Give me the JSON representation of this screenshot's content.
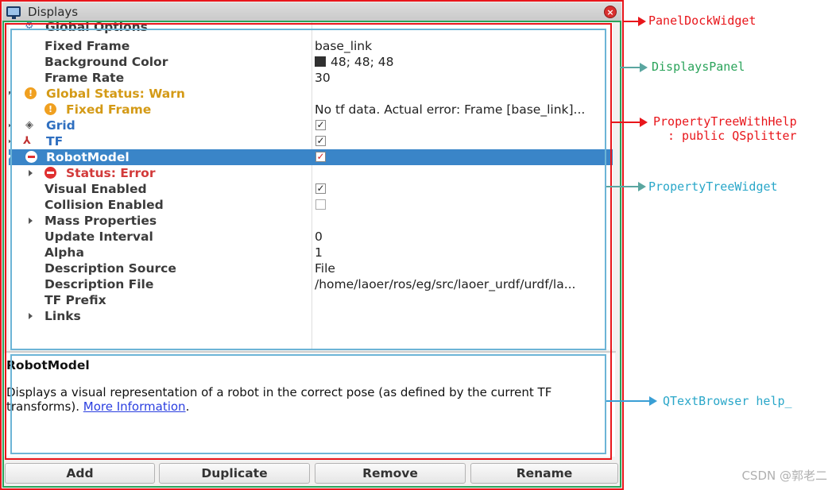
{
  "window": {
    "title": "Displays",
    "close_icon": "close-icon"
  },
  "tree": {
    "rows": [
      {
        "label": "Global Options",
        "value": ""
      },
      {
        "label": "Fixed Frame",
        "value": "base_link"
      },
      {
        "label": "Background Color",
        "value": "48; 48; 48",
        "swatch": "#303030"
      },
      {
        "label": "Frame Rate",
        "value": "30"
      },
      {
        "label": "Global Status: Warn",
        "value": ""
      },
      {
        "label": "Fixed Frame",
        "value": "No tf data.  Actual error: Frame [base_link]..."
      },
      {
        "label": "Grid",
        "checked": true
      },
      {
        "label": "TF",
        "checked": true
      },
      {
        "label": "RobotModel",
        "checked": true
      },
      {
        "label": "Status: Error",
        "value": ""
      },
      {
        "label": "Visual Enabled",
        "checked": true
      },
      {
        "label": "Collision Enabled",
        "checked": false
      },
      {
        "label": "Mass Properties",
        "value": ""
      },
      {
        "label": "Update Interval",
        "value": "0"
      },
      {
        "label": "Alpha",
        "value": "1"
      },
      {
        "label": "Description Source",
        "value": "File"
      },
      {
        "label": "Description File",
        "value": "/home/laoer/ros/eg/src/laoer_urdf/urdf/la..."
      },
      {
        "label": "TF Prefix",
        "value": ""
      },
      {
        "label": "Links",
        "value": ""
      }
    ]
  },
  "help": {
    "title": "RobotModel",
    "body": "Displays a visual representation of a robot in the correct pose (as defined by the current TF transforms).",
    "link": "More Information",
    "after_link": "."
  },
  "buttons": {
    "add": "Add",
    "duplicate": "Duplicate",
    "remove": "Remove",
    "rename": "Rename"
  },
  "annotations": {
    "panel_dock": "PanelDockWidget",
    "displays_panel": "DisplaysPanel",
    "tree_with_help_1": "PropertyTreeWithHelp",
    "tree_with_help_2": ": public QSplitter",
    "tree_widget": "PropertyTreeWidget",
    "text_browser": "QTextBrowser help_"
  },
  "colors": {
    "red": "#e8161b",
    "green": "#2aa35a",
    "teal": "#5aa6a0",
    "blue": "#3a9fd5",
    "selection": "#3a85c8"
  },
  "watermark": "CSDN @郭老二"
}
